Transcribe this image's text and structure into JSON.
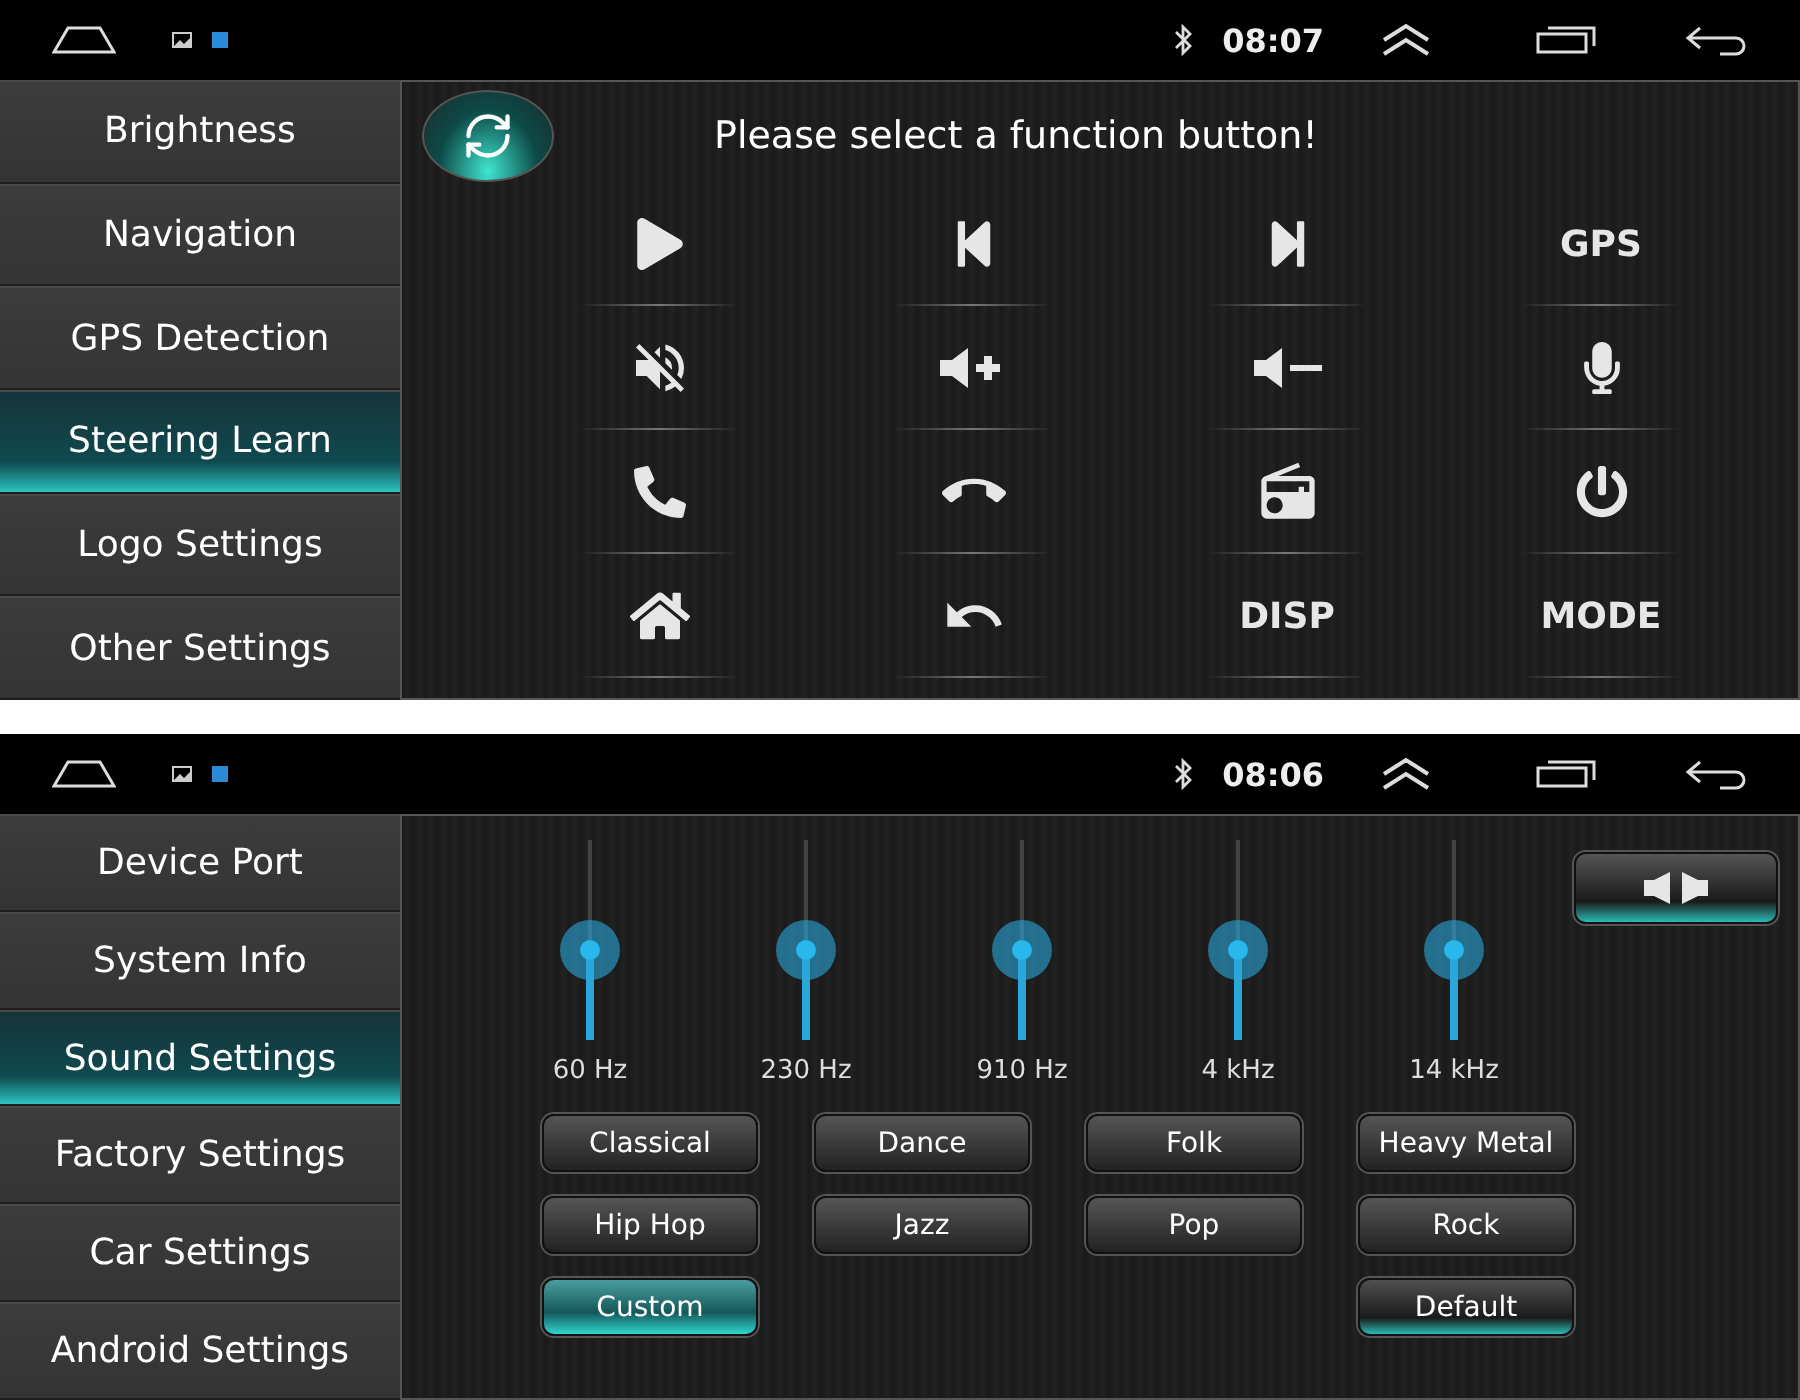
{
  "screens": [
    {
      "kind": "functions",
      "status_bar": {
        "time": "08:07"
      },
      "sidebar": {
        "items": [
          {
            "label": "Brightness",
            "selected": false
          },
          {
            "label": "Navigation",
            "selected": false
          },
          {
            "label": "GPS Detection",
            "selected": false
          },
          {
            "label": "Steering Learn",
            "selected": true
          },
          {
            "label": "Logo Settings",
            "selected": false
          },
          {
            "label": "Other Settings",
            "selected": false
          }
        ]
      },
      "prompt": "Please select a function button!",
      "functions": [
        {
          "kind": "play"
        },
        {
          "kind": "prev"
        },
        {
          "kind": "next"
        },
        {
          "kind": "label",
          "label": "GPS"
        },
        {
          "kind": "mute"
        },
        {
          "kind": "volup"
        },
        {
          "kind": "voldown"
        },
        {
          "kind": "mic"
        },
        {
          "kind": "phone"
        },
        {
          "kind": "hangup"
        },
        {
          "kind": "radio"
        },
        {
          "kind": "power"
        },
        {
          "kind": "home"
        },
        {
          "kind": "back"
        },
        {
          "kind": "label",
          "label": "DISP"
        },
        {
          "kind": "label",
          "label": "MODE"
        }
      ]
    },
    {
      "kind": "sound",
      "status_bar": {
        "time": "08:06"
      },
      "sidebar": {
        "items": [
          {
            "label": "Device Port",
            "selected": false
          },
          {
            "label": "System Info",
            "selected": false
          },
          {
            "label": "Sound Settings",
            "selected": true
          },
          {
            "label": "Factory Settings",
            "selected": false
          },
          {
            "label": "Car Settings",
            "selected": false
          },
          {
            "label": "Android Settings",
            "selected": false
          }
        ]
      },
      "bands": [
        {
          "label": "60 Hz",
          "level": 0.45
        },
        {
          "label": "230 Hz",
          "level": 0.45
        },
        {
          "label": "910 Hz",
          "level": 0.45
        },
        {
          "label": "4 kHz",
          "level": 0.45
        },
        {
          "label": "14 kHz",
          "level": 0.45
        }
      ],
      "presets": [
        {
          "label": "Classical",
          "selected": false
        },
        {
          "label": "Dance",
          "selected": false
        },
        {
          "label": "Folk",
          "selected": false
        },
        {
          "label": "Heavy Metal",
          "selected": false
        },
        {
          "label": "Hip Hop",
          "selected": false
        },
        {
          "label": "Jazz",
          "selected": false
        },
        {
          "label": "Pop",
          "selected": false
        },
        {
          "label": "Rock",
          "selected": false
        },
        {
          "label": "Custom",
          "selected": true
        }
      ],
      "default_button": "Default"
    }
  ]
}
